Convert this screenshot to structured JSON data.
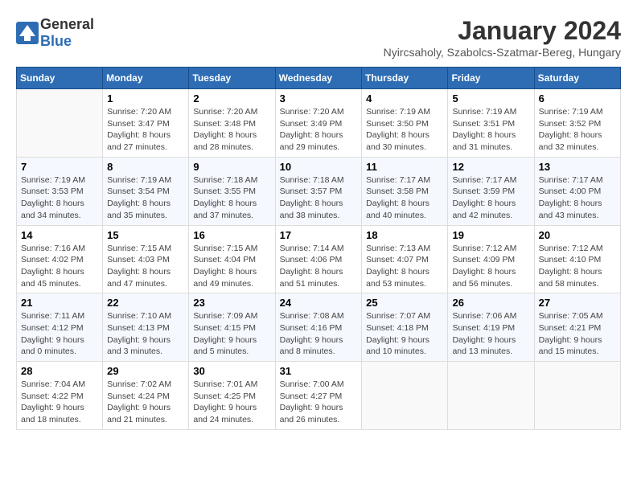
{
  "header": {
    "logo": {
      "general": "General",
      "blue": "Blue"
    },
    "title": "January 2024",
    "location": "Nyircsaholy, Szabolcs-Szatmar-Bereg, Hungary"
  },
  "columns": [
    "Sunday",
    "Monday",
    "Tuesday",
    "Wednesday",
    "Thursday",
    "Friday",
    "Saturday"
  ],
  "weeks": [
    [
      {
        "day": "",
        "info": ""
      },
      {
        "day": "1",
        "info": "Sunrise: 7:20 AM\nSunset: 3:47 PM\nDaylight: 8 hours\nand 27 minutes."
      },
      {
        "day": "2",
        "info": "Sunrise: 7:20 AM\nSunset: 3:48 PM\nDaylight: 8 hours\nand 28 minutes."
      },
      {
        "day": "3",
        "info": "Sunrise: 7:20 AM\nSunset: 3:49 PM\nDaylight: 8 hours\nand 29 minutes."
      },
      {
        "day": "4",
        "info": "Sunrise: 7:19 AM\nSunset: 3:50 PM\nDaylight: 8 hours\nand 30 minutes."
      },
      {
        "day": "5",
        "info": "Sunrise: 7:19 AM\nSunset: 3:51 PM\nDaylight: 8 hours\nand 31 minutes."
      },
      {
        "day": "6",
        "info": "Sunrise: 7:19 AM\nSunset: 3:52 PM\nDaylight: 8 hours\nand 32 minutes."
      }
    ],
    [
      {
        "day": "7",
        "info": "Sunrise: 7:19 AM\nSunset: 3:53 PM\nDaylight: 8 hours\nand 34 minutes."
      },
      {
        "day": "8",
        "info": "Sunrise: 7:19 AM\nSunset: 3:54 PM\nDaylight: 8 hours\nand 35 minutes."
      },
      {
        "day": "9",
        "info": "Sunrise: 7:18 AM\nSunset: 3:55 PM\nDaylight: 8 hours\nand 37 minutes."
      },
      {
        "day": "10",
        "info": "Sunrise: 7:18 AM\nSunset: 3:57 PM\nDaylight: 8 hours\nand 38 minutes."
      },
      {
        "day": "11",
        "info": "Sunrise: 7:17 AM\nSunset: 3:58 PM\nDaylight: 8 hours\nand 40 minutes."
      },
      {
        "day": "12",
        "info": "Sunrise: 7:17 AM\nSunset: 3:59 PM\nDaylight: 8 hours\nand 42 minutes."
      },
      {
        "day": "13",
        "info": "Sunrise: 7:17 AM\nSunset: 4:00 PM\nDaylight: 8 hours\nand 43 minutes."
      }
    ],
    [
      {
        "day": "14",
        "info": "Sunrise: 7:16 AM\nSunset: 4:02 PM\nDaylight: 8 hours\nand 45 minutes."
      },
      {
        "day": "15",
        "info": "Sunrise: 7:15 AM\nSunset: 4:03 PM\nDaylight: 8 hours\nand 47 minutes."
      },
      {
        "day": "16",
        "info": "Sunrise: 7:15 AM\nSunset: 4:04 PM\nDaylight: 8 hours\nand 49 minutes."
      },
      {
        "day": "17",
        "info": "Sunrise: 7:14 AM\nSunset: 4:06 PM\nDaylight: 8 hours\nand 51 minutes."
      },
      {
        "day": "18",
        "info": "Sunrise: 7:13 AM\nSunset: 4:07 PM\nDaylight: 8 hours\nand 53 minutes."
      },
      {
        "day": "19",
        "info": "Sunrise: 7:12 AM\nSunset: 4:09 PM\nDaylight: 8 hours\nand 56 minutes."
      },
      {
        "day": "20",
        "info": "Sunrise: 7:12 AM\nSunset: 4:10 PM\nDaylight: 8 hours\nand 58 minutes."
      }
    ],
    [
      {
        "day": "21",
        "info": "Sunrise: 7:11 AM\nSunset: 4:12 PM\nDaylight: 9 hours\nand 0 minutes."
      },
      {
        "day": "22",
        "info": "Sunrise: 7:10 AM\nSunset: 4:13 PM\nDaylight: 9 hours\nand 3 minutes."
      },
      {
        "day": "23",
        "info": "Sunrise: 7:09 AM\nSunset: 4:15 PM\nDaylight: 9 hours\nand 5 minutes."
      },
      {
        "day": "24",
        "info": "Sunrise: 7:08 AM\nSunset: 4:16 PM\nDaylight: 9 hours\nand 8 minutes."
      },
      {
        "day": "25",
        "info": "Sunrise: 7:07 AM\nSunset: 4:18 PM\nDaylight: 9 hours\nand 10 minutes."
      },
      {
        "day": "26",
        "info": "Sunrise: 7:06 AM\nSunset: 4:19 PM\nDaylight: 9 hours\nand 13 minutes."
      },
      {
        "day": "27",
        "info": "Sunrise: 7:05 AM\nSunset: 4:21 PM\nDaylight: 9 hours\nand 15 minutes."
      }
    ],
    [
      {
        "day": "28",
        "info": "Sunrise: 7:04 AM\nSunset: 4:22 PM\nDaylight: 9 hours\nand 18 minutes."
      },
      {
        "day": "29",
        "info": "Sunrise: 7:02 AM\nSunset: 4:24 PM\nDaylight: 9 hours\nand 21 minutes."
      },
      {
        "day": "30",
        "info": "Sunrise: 7:01 AM\nSunset: 4:25 PM\nDaylight: 9 hours\nand 24 minutes."
      },
      {
        "day": "31",
        "info": "Sunrise: 7:00 AM\nSunset: 4:27 PM\nDaylight: 9 hours\nand 26 minutes."
      },
      {
        "day": "",
        "info": ""
      },
      {
        "day": "",
        "info": ""
      },
      {
        "day": "",
        "info": ""
      }
    ]
  ]
}
